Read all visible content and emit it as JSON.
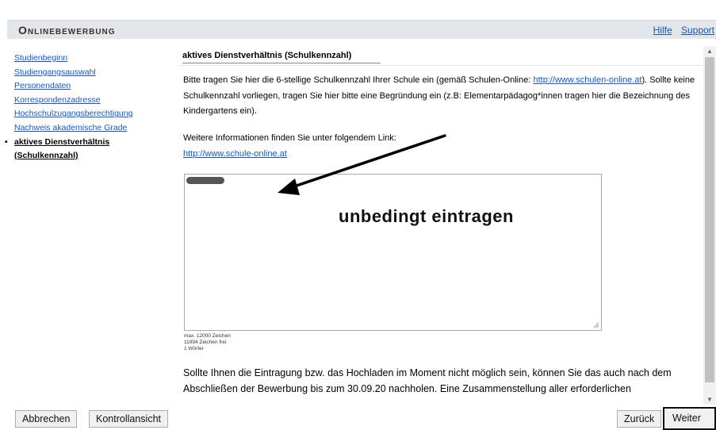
{
  "header": {
    "title": "Onlinebewerbung",
    "links": [
      "Hilfe",
      "Support"
    ]
  },
  "sidebar": {
    "items": [
      "Studienbeginn",
      "Studiengangsauswahl",
      "Personendaten",
      "Korrespondenzadresse",
      "Hochschulzugangsberechtigung",
      "Nachweis akademische Grade"
    ],
    "active": "aktives Dienstverhältnis (Schulkennzahl)"
  },
  "main": {
    "section_title": "aktives Dienstverhältnis (Schulkennzahl)",
    "intro_pre": "Bitte tragen Sie hier die 6-stellige Schulkennzahl Ihrer Schule ein (gemäß Schulen-Online: ",
    "intro_link": "http://www.schulen-online.at",
    "intro_post": "). Sollte keine Schulkennzahl vorliegen, tragen Sie hier bitte eine Begründung ein (z.B: Elementarpädagog*innen tragen hier die Bezeichnung des Kindergartens ein).",
    "info_text": "Weitere Informationen finden Sie unter folgendem Link:",
    "info_link": "http://www.schule-online.at",
    "counter_max": "max. 12000 Zeichen",
    "counter_free": "11994 Zeichen frei",
    "counter_words": "1 Wörter",
    "note": "Sollte Ihnen die Eintragung bzw. das Hochladen im Moment nicht möglich sein, können Sie das auch nach dem Abschließen der Bewerbung bis zum 30.09.20 nachholen. Eine Zusammenstellung aller erforderlichen"
  },
  "annotation": {
    "text": "unbedingt eintragen"
  },
  "footer": {
    "cancel": "Abbrechen",
    "review": "Kontrollansicht",
    "back": "Zurück",
    "next": "Weiter"
  }
}
